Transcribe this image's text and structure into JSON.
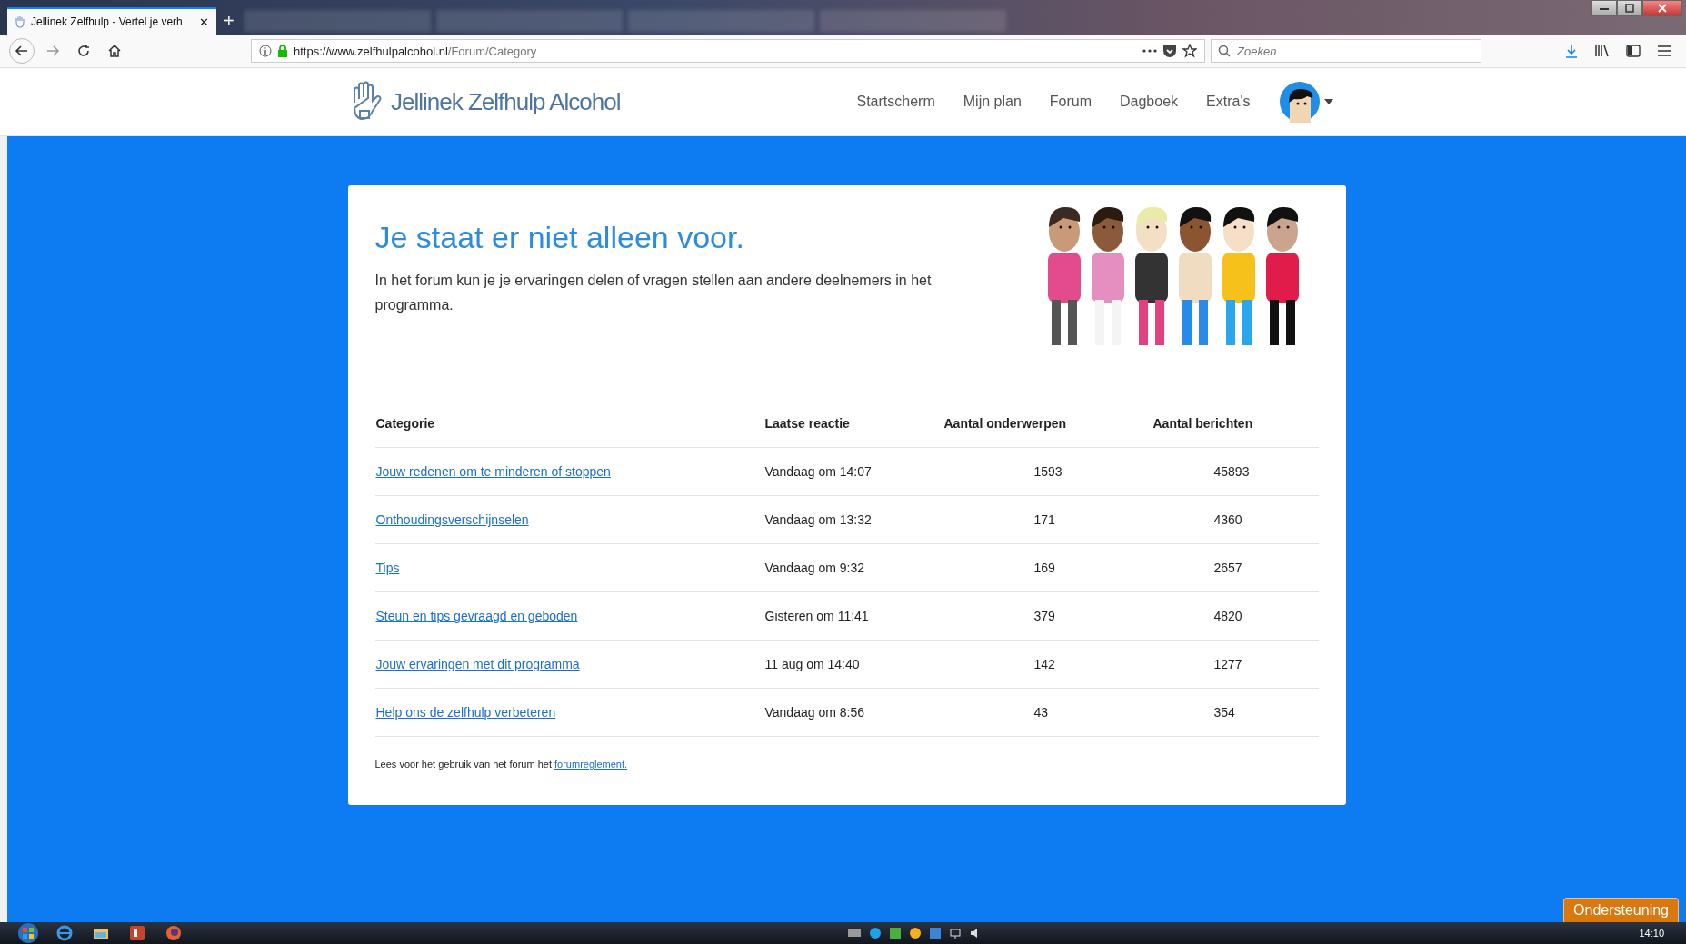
{
  "browser": {
    "tabs": [
      {
        "title": "Jellinek Zelfhulp - Vertel je verh",
        "selected": true
      }
    ],
    "close_label": "✕",
    "new_tab_label": "+",
    "url_host": "https://www.zelfhulpalcohol.nl",
    "url_path": "/Forum/Category",
    "search": {
      "placeholder": "Zoeken"
    }
  },
  "site": {
    "logo": "Jellinek Zelfhulp Alcohol",
    "nav": [
      "Startscherm",
      "Mijn plan",
      "Forum",
      "Dagboek",
      "Extra's"
    ]
  },
  "intro": {
    "title": "Je staat er niet alleen voor.",
    "text": "In het forum kun je je ervaringen delen of vragen stellen aan andere deelnemers in het programma."
  },
  "table": {
    "columns": [
      "Categorie",
      "Laatse reactie",
      "Aantal onderwerpen",
      "Aantal berichten"
    ],
    "rows": [
      {
        "category": "Jouw redenen om te minderen of stoppen",
        "last_reply": "Vandaag om 14:07",
        "topics": "1593",
        "posts": "45893"
      },
      {
        "category": "Onthoudingsverschijnselen",
        "last_reply": "Vandaag om 13:32",
        "topics": "171",
        "posts": "4360"
      },
      {
        "category": "Tips",
        "last_reply": "Vandaag om 9:32",
        "topics": "169",
        "posts": "2657"
      },
      {
        "category": "Steun en tips gevraagd en geboden",
        "last_reply": "Gisteren om 11:41",
        "topics": "379",
        "posts": "4820"
      },
      {
        "category": "Jouw ervaringen met dit programma",
        "last_reply": "11 aug om 14:40",
        "topics": "142",
        "posts": "1277"
      },
      {
        "category": "Help ons de zelfhulp verbeteren",
        "last_reply": "Vandaag om 8:56",
        "topics": "43",
        "posts": "354"
      }
    ]
  },
  "footer_note": {
    "text": "Lees voor het gebruik van het forum het",
    "link": "forumreglement."
  },
  "support_button": "Ondersteuning",
  "taskbar": {
    "clock": "14:10"
  }
}
